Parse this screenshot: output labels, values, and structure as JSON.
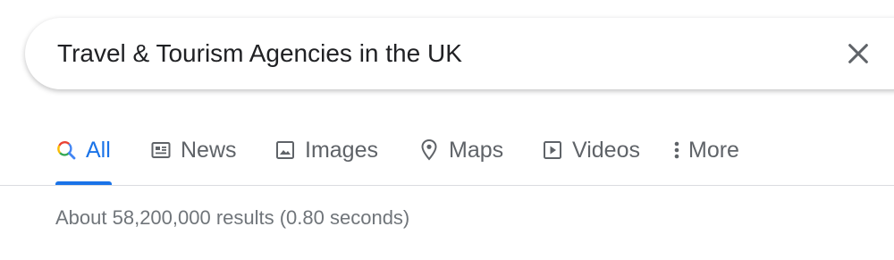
{
  "search": {
    "query": "Travel & Tourism Agencies in the UK"
  },
  "tabs": [
    {
      "label": "All",
      "icon": "search-icon",
      "active": true
    },
    {
      "label": "News",
      "icon": "news-icon",
      "active": false
    },
    {
      "label": "Images",
      "icon": "image-icon",
      "active": false
    },
    {
      "label": "Maps",
      "icon": "map-pin-icon",
      "active": false
    },
    {
      "label": "Videos",
      "icon": "video-icon",
      "active": false
    },
    {
      "label": "More",
      "icon": "more-vert-icon",
      "active": false
    }
  ],
  "result_stats": "About 58,200,000 results (0.80 seconds)",
  "colors": {
    "accent": "#1a73e8",
    "tab_text": "#5f6368",
    "stats_text": "#70757a",
    "divider": "#dadce0"
  }
}
